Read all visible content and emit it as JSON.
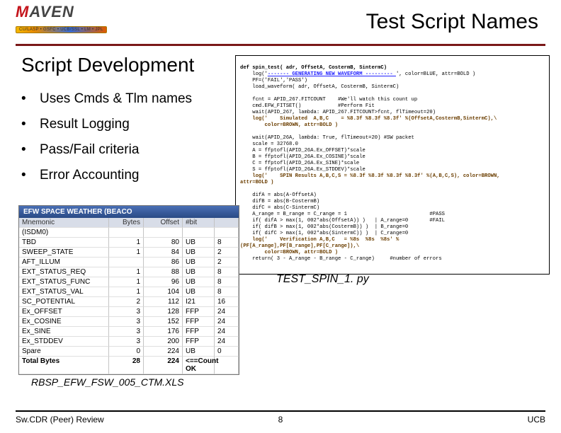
{
  "logo": {
    "brand_first": "M",
    "brand_rest": "AVEN",
    "sub": "CU/LASP • GSFC • UCB/SSL • LM • JPL"
  },
  "slide_title": "Test Script Names",
  "section_title": "Script Development",
  "bullets": {
    "b1": "Uses Cmds & Tlm names",
    "b2": "Result Logging",
    "b3": "Pass/Fail criteria",
    "b4": "Error Accounting"
  },
  "code": {
    "l01": "def spin_test( adr, OffsetA, CostermB, SintermC)",
    "l02a": "    log('",
    "l02b": "------- GENERATING NEW WAVEFORM --------- ",
    "l02c": "', color=BLUE, attr=BOLD )",
    "l03": "    PF=('FAIL','PASS')",
    "l04": "    load_waveform( adr, OffsetA, CostermB, SintermC)",
    "l05": "",
    "l06": "    fcnt = APID_267.FITCOUNT    #We'll watch this count up",
    "l07": "    cmd.EFW_FITSET()            #Perform Fit",
    "l08": "    wait(APID_267, lambda: APID_267.FITCOUNT>fcnt, flTimeout=20)",
    "l09a": "    log('    Simulated  A,B,C    = %8.3f %8.3f %8.3f' %(OffsetA,CostermB,SintermC),\\",
    "l09b": "        color=BROWN, attr=BOLD )",
    "l10": "",
    "l11": "    wait(APID_26A, lambda: True, flTimeout=20) #SW packet",
    "l12": "    scale = 32768.0",
    "l13": "    A = ffptofl(APID_26A.Ex_OFFSET)*scale",
    "l14": "    B = ffptofl(APID_26A.Ex_COSINE)*scale",
    "l15": "    C = ffptofl(APID_26A.Ex_SINE)*scale",
    "l16": "    S = ffptofl(APID_26A.Ex_STDDEV)*scale",
    "l17a": "    log('    SPIN Results A,B,C,S = %8.3f %8.3f %8.3f %8.3f' %(A,B,C,S), color=BROWN,",
    "l17b": "attr=BOLD )",
    "l18": "",
    "l19": "    difA = abs(A-OffsetA)",
    "l20": "    difB = abs(B-CostermB)",
    "l21": "    difC = abs(C-SintermC)",
    "l22": "    A_range = B_range = C_range = 1                           #PASS",
    "l23": "    if( difA > max(1, 002*abs(OffsetA)) )   | A_range=0       #FAIL",
    "l24": "    if( difB > max(1, 002*abs(CostermB)) )  | B_range=0",
    "l25": "    if( difC > max(1, 002*abs(SintermC)) )  | C_range=0",
    "l26a": "    log('    Verification A,B,C   = %8s  %8s  %8s' %",
    "l26b": "(PF[A_range],PF[B_range],PF[C_range]),\\",
    "l26c": "        color=BROWN, attr=BOLD )",
    "l27": "    return( 3 - A_range - B_range - C_range)     #number of errors"
  },
  "py_caption": "TEST_SPIN_1. py",
  "xls_caption": "RBSP_EFW_FSW_005_CTM.XLS",
  "table": {
    "header": "EFW      SPACE WEATHER (BEACO",
    "cols": {
      "mn": "Mnemonic",
      "by": "Bytes",
      "of": "Offset",
      "bi": "#bit",
      "no": ""
    },
    "rows": [
      {
        "mn": "(ISDM0)",
        "by": "",
        "of": "",
        "bi": "",
        "no": ""
      },
      {
        "mn": "TBD",
        "by": "1",
        "of": "80",
        "bi": "UB",
        "no": "8"
      },
      {
        "mn": "SWEEP_STATE",
        "by": "1",
        "of": "84",
        "bi": "UB",
        "no": "2"
      },
      {
        "mn": "AFT_ILLUM",
        "by": "",
        "of": "86",
        "bi": "UB",
        "no": "2"
      },
      {
        "mn": "EXT_STATUS_REQ",
        "by": "1",
        "of": "88",
        "bi": "UB",
        "no": "8"
      },
      {
        "mn": "EXT_STATUS_FUNC",
        "by": "1",
        "of": "96",
        "bi": "UB",
        "no": "8"
      },
      {
        "mn": "EXT_STATUS_VAL",
        "by": "1",
        "of": "104",
        "bi": "UB",
        "no": "8"
      },
      {
        "mn": "SC_POTENTIAL",
        "by": "2",
        "of": "112",
        "bi": "I21",
        "no": "16"
      },
      {
        "mn": "Ex_OFFSET",
        "by": "3",
        "of": "128",
        "bi": "FFP",
        "no": "24"
      },
      {
        "mn": "Ex_COSINE",
        "by": "3",
        "of": "152",
        "bi": "FFP",
        "no": "24"
      },
      {
        "mn": "Ex_SINE",
        "by": "3",
        "of": "176",
        "bi": "FFP",
        "no": "24"
      },
      {
        "mn": "Ex_STDDEV",
        "by": "3",
        "of": "200",
        "bi": "FFP",
        "no": "24"
      },
      {
        "mn": "Spare",
        "by": "0",
        "of": "224",
        "bi": "UB",
        "no": "0"
      },
      {
        "mn": "Total Bytes",
        "by": "28",
        "of": "224",
        "bi": "<==Count OK",
        "no": ""
      }
    ]
  },
  "footer": {
    "left": "Sw.CDR (Peer) Review",
    "page": "8",
    "right": "UCB"
  }
}
